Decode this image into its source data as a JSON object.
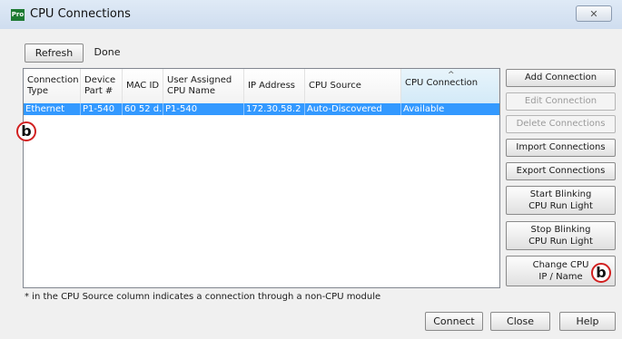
{
  "window": {
    "app_icon": "Pro",
    "title": "CPU Connections",
    "close_glyph": "✕"
  },
  "toolbar": {
    "refresh_label": "Refresh",
    "done_label": "Done"
  },
  "table": {
    "sort_glyph": "^",
    "columns": [
      {
        "label": "Connection Type"
      },
      {
        "label": "Device Part #"
      },
      {
        "label": "MAC ID"
      },
      {
        "label": "User Assigned CPU Name"
      },
      {
        "label": "IP Address"
      },
      {
        "label": "CPU Source"
      },
      {
        "label": "CPU Connection"
      }
    ],
    "rows": [
      {
        "selected": true,
        "cells": [
          "Ethernet",
          "P1-540",
          "60 52 d...",
          "P1-540",
          "172.30.58.2",
          "Auto-Discovered",
          "Available"
        ]
      }
    ]
  },
  "side_buttons": [
    {
      "label": "Add Connection",
      "enabled": true
    },
    {
      "label": "Edit Connection",
      "enabled": false
    },
    {
      "label": "Delete Connections",
      "enabled": false
    },
    {
      "label": "Import Connections",
      "enabled": true
    },
    {
      "label": "Export Connections",
      "enabled": true
    },
    {
      "label": "Start Blinking\nCPU Run Light",
      "enabled": true
    },
    {
      "label": "Stop Blinking\nCPU Run Light",
      "enabled": true
    },
    {
      "label": "Change CPU\nIP / Name",
      "enabled": true
    }
  ],
  "note": "* in the CPU Source column indicates a connection through a non-CPU module",
  "bottom_buttons": {
    "connect": "Connect",
    "close": "Close",
    "help": "Help"
  },
  "annotations": {
    "marker_table": "b",
    "marker_button": "b",
    "marker_color": "#d12020"
  },
  "colors": {
    "selection": "#3399ff",
    "title_bar": "#d6e3f3"
  }
}
